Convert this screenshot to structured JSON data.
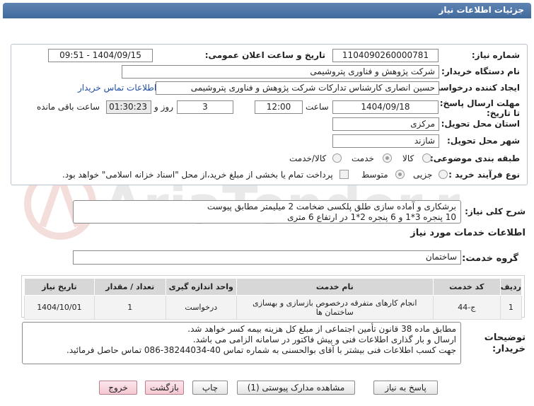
{
  "window": {
    "title": "جزئیات اطلاعات نیاز"
  },
  "form": {
    "need_number": {
      "label": "شماره نیاز:",
      "value": "1104090260000781"
    },
    "announce_datetime": {
      "label": "تاریخ و ساعت اعلان عمومی:",
      "value": "1404/09/15 - 09:51"
    },
    "buyer_org": {
      "label": "نام دستگاه خریدار:",
      "value": "شرکت پژوهش و فناوری پتروشیمی"
    },
    "requester": {
      "label": "ایجاد کننده درخواست:",
      "value": "حسین انصاری کارشناس تدارکات شرکت پژوهش و فناوری پتروشیمی",
      "contact_link": "اطلاعات تماس خریدار"
    },
    "deadline": {
      "label": "مهلت ارسال پاسخ: تا تاریخ:",
      "date": "1404/09/18",
      "time_label": "ساعت",
      "time": "12:00",
      "days": "3",
      "days_label": "روز و",
      "remaining": "01:30:23",
      "remaining_label": "ساعت باقی مانده"
    },
    "province": {
      "label": "استان محل تحویل:",
      "value": "مرکزی"
    },
    "city": {
      "label": "شهر محل تحویل:",
      "value": "شازند"
    },
    "category": {
      "label": "طبقه بندی موضوعی:",
      "options": [
        "کالا",
        "خدمت",
        "کالا/خدمت"
      ]
    },
    "process": {
      "label": "نوع فرآیند خرید :",
      "options": [
        "جزیی",
        "متوسط"
      ],
      "note": "پرداخت تمام یا بخشی از مبلغ خرید،از محل \"اسناد خزانه اسلامی\" خواهد بود."
    }
  },
  "description": {
    "label": "شرح کلی نیاز:",
    "line1": "برشکاری و آماده سازی طلق پلکسی ضخامت 2 میلیمتر مطابق پیوست",
    "line2": "10 پنجره 3*1 و 6 پنجره 2*1 در ارتفاع 6 متری"
  },
  "services": {
    "section_title": "اطلاعات خدمات مورد نیاز",
    "group_label": "گروه خدمت:",
    "group_value": "ساختمان",
    "columns": [
      "ردیف",
      "کد خدمت",
      "نام خدمت",
      "واحد اندازه گیری",
      "تعداد / مقدار",
      "تاریخ نیاز"
    ],
    "rows": [
      {
        "row": "1",
        "code": "ج-44",
        "name": "انجام کارهای متفرقه درخصوص بازسازی و بهسازی ساختمان ها",
        "unit": "درخواست",
        "qty": "1",
        "date": "1404/10/01"
      }
    ]
  },
  "buyer_notes": {
    "label": "توضیحات خریدار:",
    "line1": "مطابق ماده 38 قانون تأمین اجتماعی از مبلغ کل هزینه بیمه کسر خواهد شد.",
    "line2": "ارسال و بار گذاری اطلاعات فنی و پیش فاکتور در سامانه الزامی می باشد.",
    "line3": "جهت کسب اطلاعات فنی بیشتر با آقای بوالحسنی به شماره تماس  40-38244034-086 تماس حاصل فرمائید."
  },
  "buttons": {
    "reply": "پاسخ به نیاز",
    "view_docs": "مشاهده مدارک پیوستی (1)",
    "print": "چاپ",
    "back": "بازگشت",
    "exit": "خروج"
  },
  "watermark": {
    "text": "AriaTender.net"
  }
}
